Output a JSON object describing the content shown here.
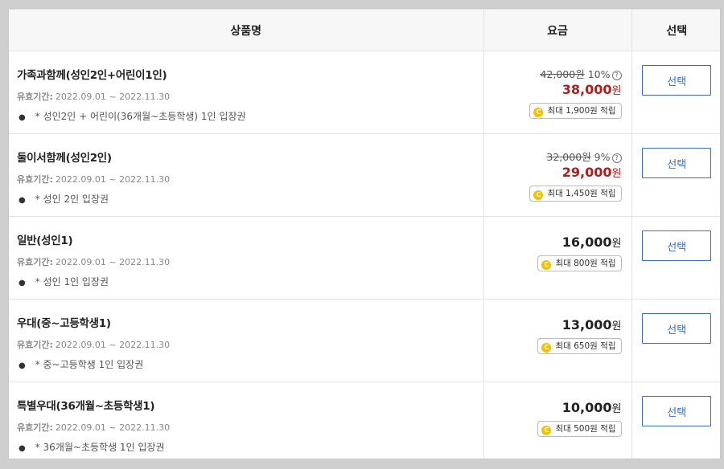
{
  "header": {
    "col_name": "상품명",
    "col_price": "요금",
    "col_select": "선택"
  },
  "products": [
    {
      "name": "가족과함께(성인2인+어린이1인)",
      "validity_label": "유효기간:",
      "validity": "2022.09.01 ~ 2022.11.30",
      "desc": "* 성인2인 + 어린이(36개월~초등학생) 1인 입장권",
      "original_price": "42,000원",
      "discount": "10%",
      "final_price": "38,000",
      "currency": "원",
      "points": "최대 1,900원 적립",
      "button": "선택"
    },
    {
      "name": "둘이서함께(성인2인)",
      "validity_label": "유효기간:",
      "validity": "2022.09.01 ~ 2022.11.30",
      "desc": "* 성인 2인 입장권",
      "original_price": "32,000원",
      "discount": "9%",
      "final_price": "29,000",
      "currency": "원",
      "points": "최대 1,450원 적립",
      "button": "선택"
    },
    {
      "name": "일반(성인1)",
      "validity_label": "유효기간:",
      "validity": "2022.09.01 ~ 2022.11.30",
      "desc": "* 성인 1인 입장권",
      "final_price": "16,000",
      "currency": "원",
      "points": "최대 800원 적립",
      "button": "선택"
    },
    {
      "name": "우대(중~고등학생1)",
      "validity_label": "유효기간:",
      "validity": "2022.09.01 ~ 2022.11.30",
      "desc": "* 중~고등학생 1인 입장권",
      "final_price": "13,000",
      "currency": "원",
      "points": "최대 650원 적립",
      "button": "선택"
    },
    {
      "name": "특별우대(36개월~초등학생1)",
      "validity_label": "유효기간:",
      "validity": "2022.09.01 ~ 2022.11.30",
      "desc": "* 36개월~초등학생 1인 입장권",
      "final_price": "10,000",
      "currency": "원",
      "points": "최대 500원 적립",
      "button": "선택"
    }
  ],
  "icons": {
    "coin_glyph": "C",
    "help_glyph": "?"
  },
  "colors": {
    "sale_price": "#b11c1c",
    "button_accent": "#3a6cc7",
    "coin": "#f2c200"
  }
}
